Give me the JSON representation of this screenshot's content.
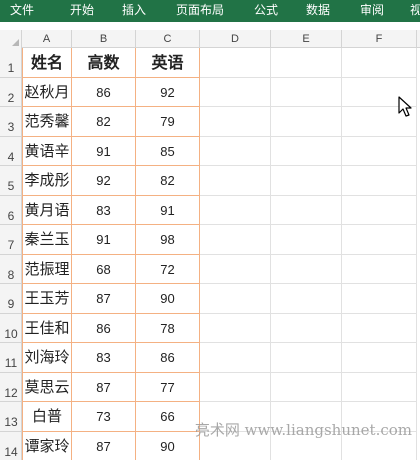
{
  "ribbon": {
    "tabs": [
      "文件",
      "开始",
      "插入",
      "页面布局",
      "公式",
      "数据",
      "审阅",
      "视"
    ]
  },
  "columns": [
    "A",
    "B",
    "C",
    "D",
    "E",
    "F"
  ],
  "rows": [
    "1",
    "2",
    "3",
    "4",
    "5",
    "6",
    "7",
    "8",
    "9",
    "10",
    "11",
    "12",
    "13",
    "14"
  ],
  "table": {
    "headers": [
      "姓名",
      "高数",
      "英语"
    ],
    "records": [
      [
        "赵秋月",
        "86",
        "92"
      ],
      [
        "范秀馨",
        "82",
        "79"
      ],
      [
        "黄语辛",
        "91",
        "85"
      ],
      [
        "李成彤",
        "92",
        "82"
      ],
      [
        "黄月语",
        "83",
        "91"
      ],
      [
        "秦兰玉",
        "91",
        "98"
      ],
      [
        "范振理",
        "68",
        "72"
      ],
      [
        "王玉芳",
        "87",
        "90"
      ],
      [
        "王佳和",
        "86",
        "78"
      ],
      [
        "刘海玲",
        "83",
        "86"
      ],
      [
        "莫思云",
        "87",
        "77"
      ],
      [
        "白普",
        "73",
        "66"
      ],
      [
        "谭家玲",
        "87",
        "90"
      ]
    ]
  },
  "watermark": "亮术网 www.liangshunet.com",
  "colors": {
    "ribbon_bg": "#217346",
    "table_border": "#f4b183"
  },
  "icons": {
    "cursor": "mouse-pointer-icon"
  }
}
